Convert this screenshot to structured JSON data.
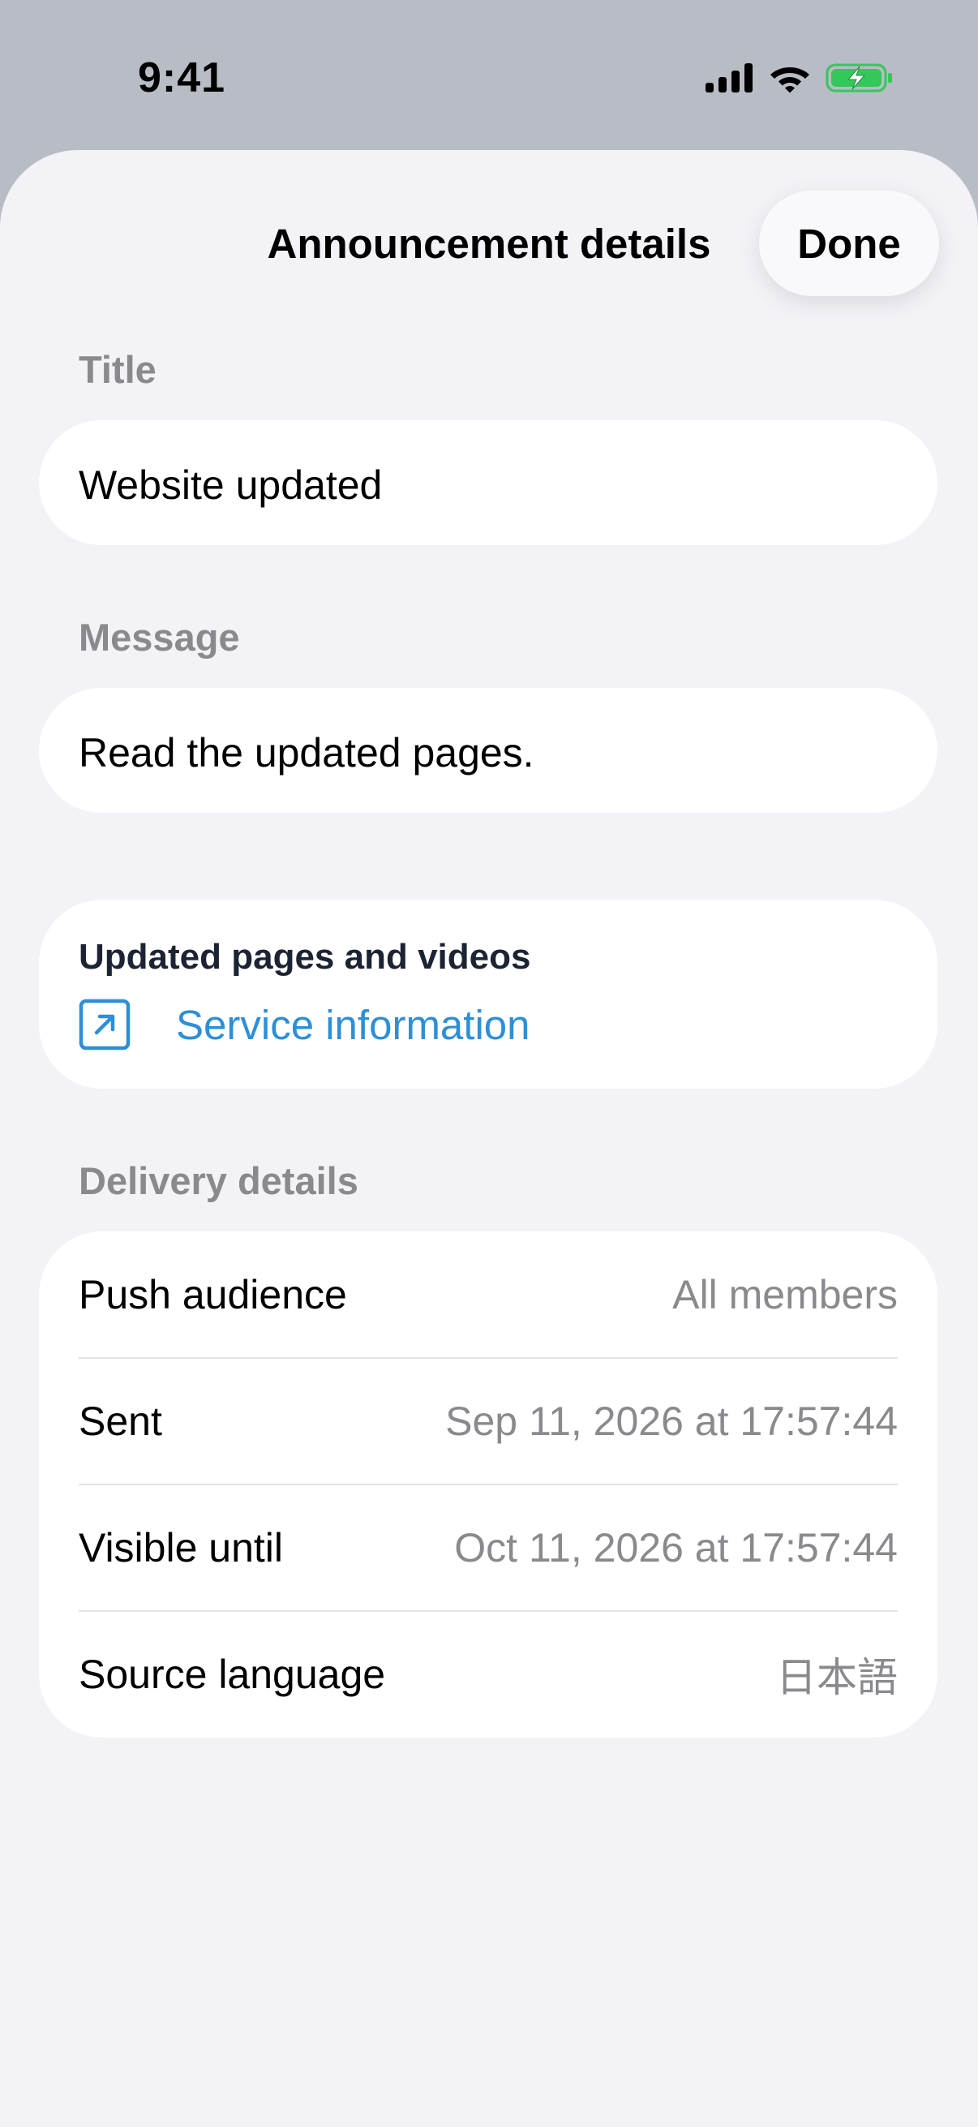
{
  "status_bar": {
    "time": "9:41",
    "icons": [
      "cellular-signal-icon",
      "wifi-icon",
      "battery-charging-icon"
    ],
    "battery_color": "#34c759"
  },
  "sheet": {
    "title": "Announcement details",
    "done_label": "Done"
  },
  "fields": {
    "title_label": "Title",
    "title_value": "Website updated",
    "message_label": "Message",
    "message_value": "Read the updated pages."
  },
  "links": {
    "heading": "Updated pages and videos",
    "items": [
      {
        "label": "Service information",
        "icon": "external-link-icon"
      }
    ],
    "link_color": "#2d8fd6"
  },
  "delivery": {
    "label": "Delivery details",
    "rows": [
      {
        "key": "Push audience",
        "value": "All members"
      },
      {
        "key": "Sent",
        "value": "Sep 11, 2026 at 17:57:44"
      },
      {
        "key": "Visible until",
        "value": "Oct 11, 2026 at 17:57:44"
      },
      {
        "key": "Source language",
        "value": "日本語"
      }
    ]
  }
}
